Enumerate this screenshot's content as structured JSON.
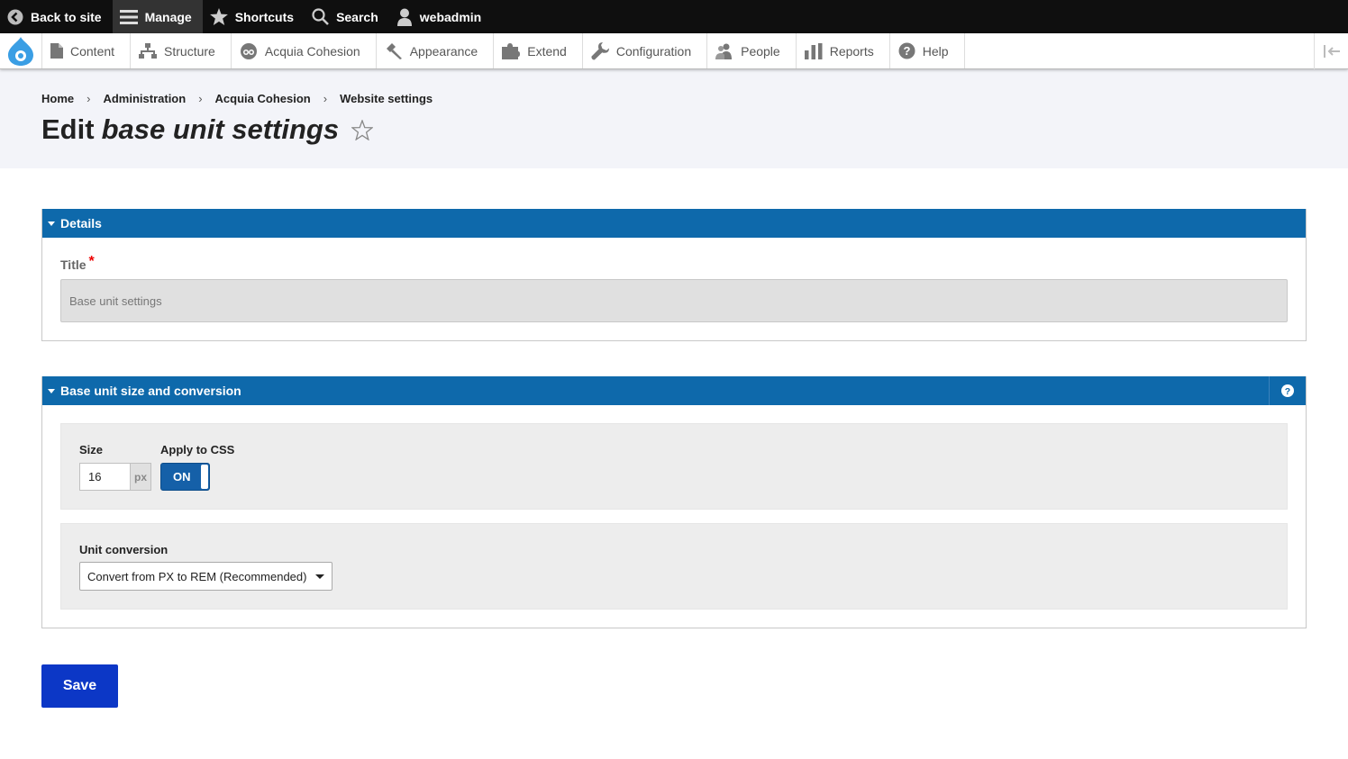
{
  "topbar": {
    "back_label": "Back to site",
    "manage_label": "Manage",
    "shortcuts_label": "Shortcuts",
    "search_label": "Search",
    "user_label": "webadmin"
  },
  "tray": {
    "items": [
      {
        "label": "Content",
        "icon": "file-icon"
      },
      {
        "label": "Structure",
        "icon": "structure-icon"
      },
      {
        "label": "Acquia Cohesion",
        "icon": "cohesion-icon"
      },
      {
        "label": "Appearance",
        "icon": "paintbrush-icon"
      },
      {
        "label": "Extend",
        "icon": "puzzle-icon"
      },
      {
        "label": "Configuration",
        "icon": "wrench-icon"
      },
      {
        "label": "People",
        "icon": "people-icon"
      },
      {
        "label": "Reports",
        "icon": "bar-chart-icon"
      },
      {
        "label": "Help",
        "icon": "help-icon"
      }
    ]
  },
  "breadcrumb": [
    "Home",
    "Administration",
    "Acquia Cohesion",
    "Website settings"
  ],
  "page": {
    "title_prefix": "Edit",
    "title_em": "base unit settings"
  },
  "details": {
    "legend": "Details",
    "title_label": "Title",
    "required_mark": "*",
    "title_value": "Base unit settings"
  },
  "base_unit": {
    "legend": "Base unit size and conversion",
    "size_label": "Size",
    "size_value": "16",
    "size_unit": "px",
    "apply_label": "Apply to CSS",
    "toggle_state": "ON",
    "conversion_label": "Unit conversion",
    "conversion_value": "Convert from PX to REM (Recommended)"
  },
  "actions": {
    "save_label": "Save"
  },
  "colors": {
    "accent_blue": "#0e69ab",
    "save_blue": "#0c37c6",
    "toolbar_black": "#0f0f0f"
  }
}
